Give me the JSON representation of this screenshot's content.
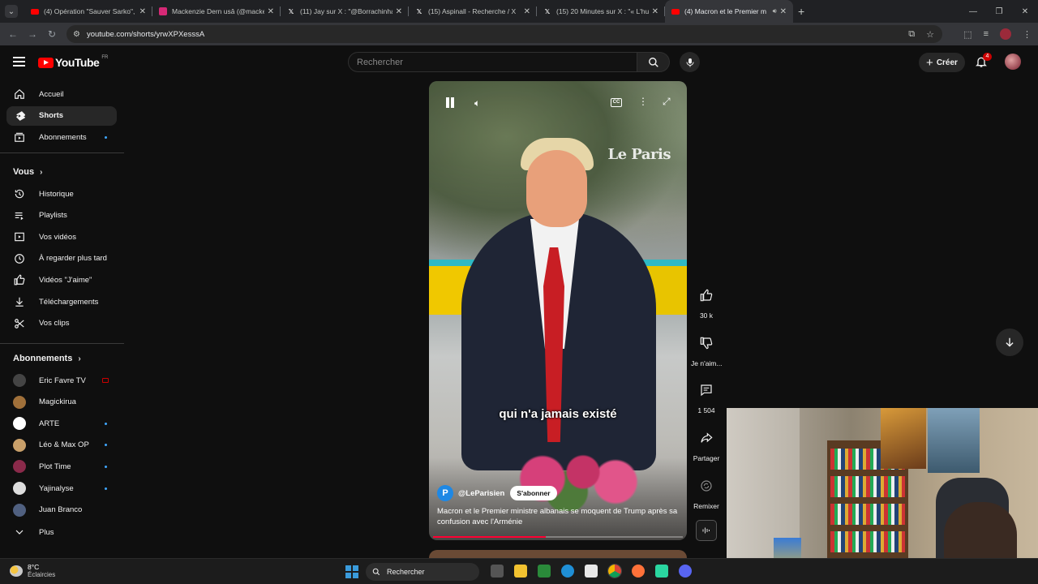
{
  "browser": {
    "tabs": [
      {
        "title": "(4) Opération \"Sauver Sarko\", le",
        "icon": "youtube-icon",
        "color": "#ff0000"
      },
      {
        "title": "Mackenzie Dern usâ (@macke",
        "icon": "instagram-icon",
        "color": "#d62976"
      },
      {
        "title": "(11) Jay sur X : \"@Borrachinhal",
        "icon": "x-icon",
        "color": "#ffffff"
      },
      {
        "title": "(15) Aspinall - Recherche / X",
        "icon": "x-icon",
        "color": "#ffffff"
      },
      {
        "title": "(15) 20 Minutes sur X : \"« L'hu",
        "icon": "x-icon",
        "color": "#ffffff"
      },
      {
        "title": "(4) Macron et le Premier m",
        "icon": "youtube-icon",
        "color": "#ff0000",
        "active": true
      }
    ],
    "url": "youtube.com/shorts/yrwXPXesssA"
  },
  "youtube": {
    "logo_text": "YouTube",
    "country": "FR",
    "search_placeholder": "Rechercher",
    "create_label": "Créer",
    "notif_count": "4",
    "sidebar": {
      "main": [
        {
          "label": "Accueil",
          "icon": "home-icon"
        },
        {
          "label": "Shorts",
          "icon": "shorts-icon",
          "active": true
        },
        {
          "label": "Abonnements",
          "icon": "subscriptions-icon",
          "dot": true
        }
      ],
      "you_header": "Vous",
      "you": [
        {
          "label": "Historique",
          "icon": "history-icon"
        },
        {
          "label": "Playlists",
          "icon": "playlists-icon"
        },
        {
          "label": "Vos vidéos",
          "icon": "your-videos-icon"
        },
        {
          "label": "À regarder plus tard",
          "icon": "watch-later-icon"
        },
        {
          "label": "Vidéos \"J'aime\"",
          "icon": "liked-icon"
        },
        {
          "label": "Téléchargements",
          "icon": "download-icon"
        },
        {
          "label": "Vos clips",
          "icon": "clips-icon"
        }
      ],
      "subs_header": "Abonnements",
      "subs": [
        {
          "label": "Eric Favre TV",
          "color": "#444",
          "live": true
        },
        {
          "label": "Magickiruа",
          "color": "#a0703a"
        },
        {
          "label": "ARTE",
          "color": "#ffffff",
          "dot": true
        },
        {
          "label": "Léo & Max OP",
          "color": "#c9a06a",
          "dot": true
        },
        {
          "label": "Plot Time",
          "color": "#8a2a4a",
          "dot": true
        },
        {
          "label": "Yajinalyse",
          "color": "#dddddd",
          "dot": true
        },
        {
          "label": "Juan Branco",
          "color": "#506080"
        }
      ],
      "more_label": "Plus"
    },
    "short": {
      "watermark": "Le Paris",
      "subtitle": "qui n'a jamais existé",
      "channel_initial": "P",
      "channel": "@LeParisien",
      "subscribe_label": "S'abonner",
      "title": "Macron et le Premier ministre albanais se moquent de Trump après sa confusion avec l'Arménie",
      "progress": 0.45
    },
    "actions": {
      "likes": "30 k",
      "dislike_label": "Je n'aim...",
      "comments": "1 504",
      "share_label": "Partager",
      "remix_label": "Remixer"
    }
  },
  "taskbar": {
    "temp": "8°C",
    "weather": "Éclaircies",
    "search_label": "Rechercher"
  }
}
